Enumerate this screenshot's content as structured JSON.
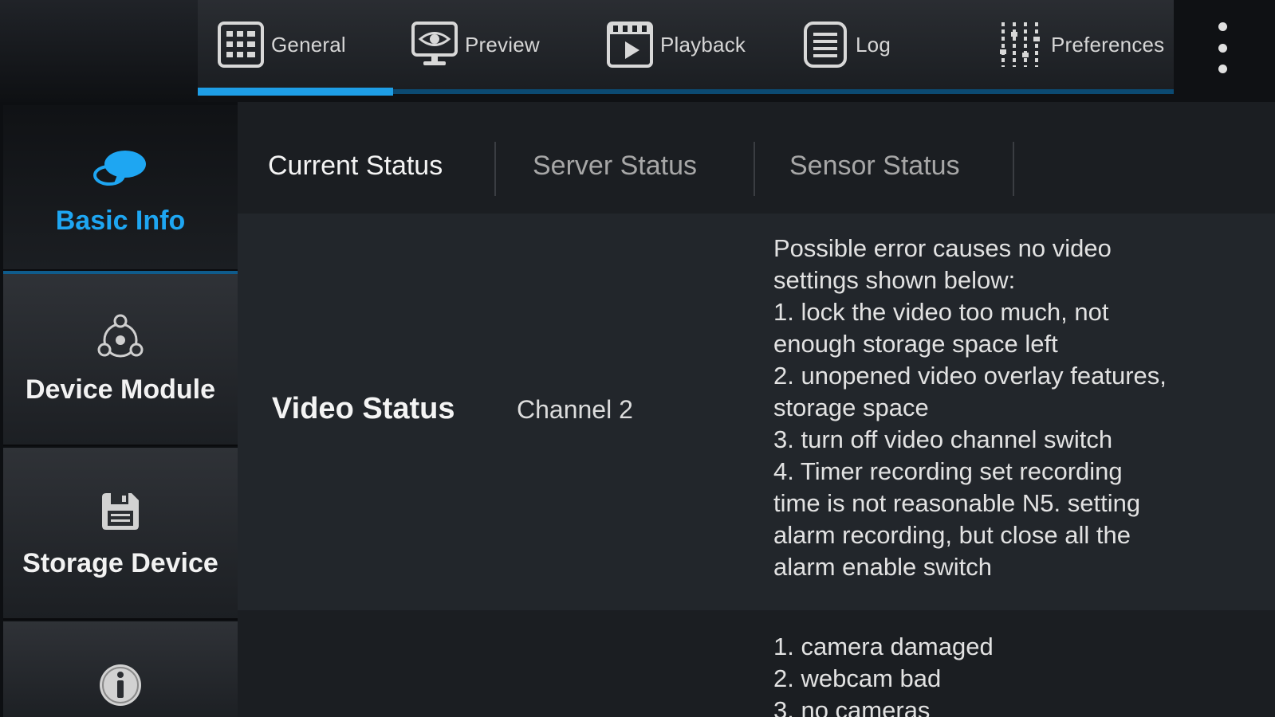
{
  "topnav": {
    "items": [
      {
        "label": "General",
        "icon": "grid-icon"
      },
      {
        "label": "Preview",
        "icon": "eye-monitor-icon"
      },
      {
        "label": "Playback",
        "icon": "video-play-icon"
      },
      {
        "label": "Log",
        "icon": "list-icon"
      },
      {
        "label": "Preferences",
        "icon": "sliders-icon"
      }
    ],
    "more_icon": "more-vertical-icon",
    "progress_fraction": 0.2,
    "accent": "#1e9ee6"
  },
  "sidebar": {
    "items": [
      {
        "label": "Basic Info",
        "icon": "chat-bubbles-icon",
        "active": true
      },
      {
        "label": "Device Module",
        "icon": "network-nodes-icon",
        "active": false
      },
      {
        "label": "Storage Device",
        "icon": "floppy-disk-icon",
        "active": false
      },
      {
        "label": "",
        "icon": "info-icon",
        "active": false
      }
    ],
    "active_color": "#1ea6f2"
  },
  "tabs": [
    {
      "label": "Current Status",
      "active": true
    },
    {
      "label": "Server Status",
      "active": false
    },
    {
      "label": "Sensor Status",
      "active": false
    }
  ],
  "rows": [
    {
      "title": "Video Status",
      "channel": "Channel 2",
      "lines": [
        "Possible error causes no video",
        "settings shown below:",
        "1. lock the video too much, not",
        "enough storage space left",
        "2. unopened video overlay features,",
        "storage space",
        "3. turn off video channel switch",
        "4. Timer recording set recording",
        "time is not reasonable N5. setting",
        "alarm recording, but close all the",
        "alarm enable switch"
      ]
    },
    {
      "title": "",
      "channel": "",
      "lines": [
        "1. camera damaged",
        "2. webcam bad",
        "3. no cameras"
      ]
    }
  ]
}
